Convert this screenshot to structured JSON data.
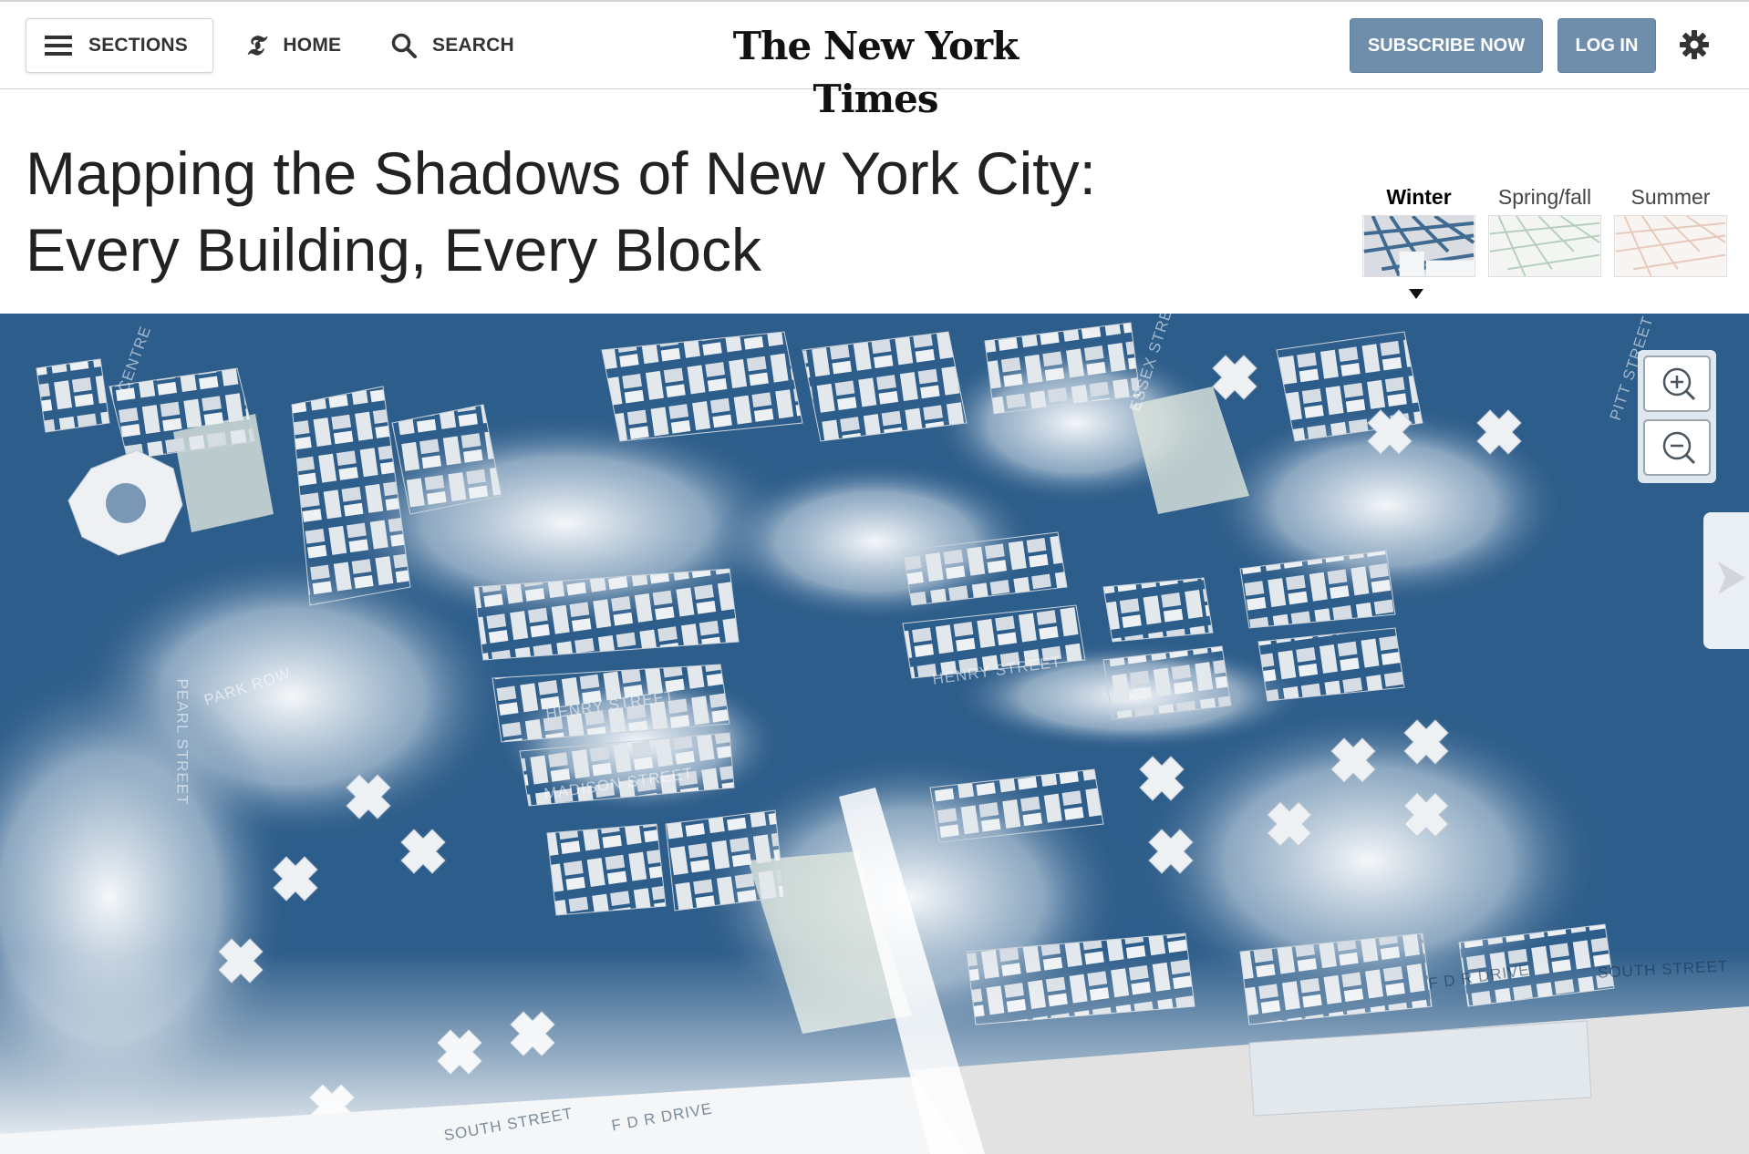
{
  "header": {
    "sections_label": "SECTIONS",
    "home_label": "HOME",
    "search_label": "SEARCH",
    "masthead": "The New York Times",
    "subscribe_label": "SUBSCRIBE NOW",
    "login_label": "LOG IN",
    "icons": {
      "sections": "hamburger-icon",
      "home": "nyt-t-logo-icon",
      "search": "search-icon",
      "settings": "gear-icon"
    }
  },
  "article": {
    "headline_line1": "Mapping the Shadows of New York City:",
    "headline_line2": "Every Building, Every Block"
  },
  "seasons": {
    "active": "Winter",
    "items": [
      {
        "label": "Winter"
      },
      {
        "label": "Spring/fall"
      },
      {
        "label": "Summer"
      }
    ]
  },
  "map": {
    "street_labels": {
      "centre": "CENTRE",
      "park_row": "PARK ROW",
      "pearl": "PEARL STREET",
      "henry_west": "HENRY STREET",
      "madison": "MADISON STREET",
      "henry_east": "HENRY STREET",
      "essex": "ESSEX STREET",
      "pitt": "PITT STREET",
      "south_west": "SOUTH STREET",
      "fdr_west": "F D R DRIVE",
      "fdr_east": "F D R DRIVE",
      "south_east": "SOUTH STREET"
    },
    "controls": {
      "zoom_in": "zoom-in-icon",
      "zoom_out": "zoom-out-icon",
      "next": "next-arrow-icon"
    },
    "colors": {
      "shadow": "#2d5d8a",
      "building": "#e3e8ed",
      "light": "#f2f4f6",
      "park": "#dfe6dd",
      "water": "#e2e2e2"
    }
  }
}
